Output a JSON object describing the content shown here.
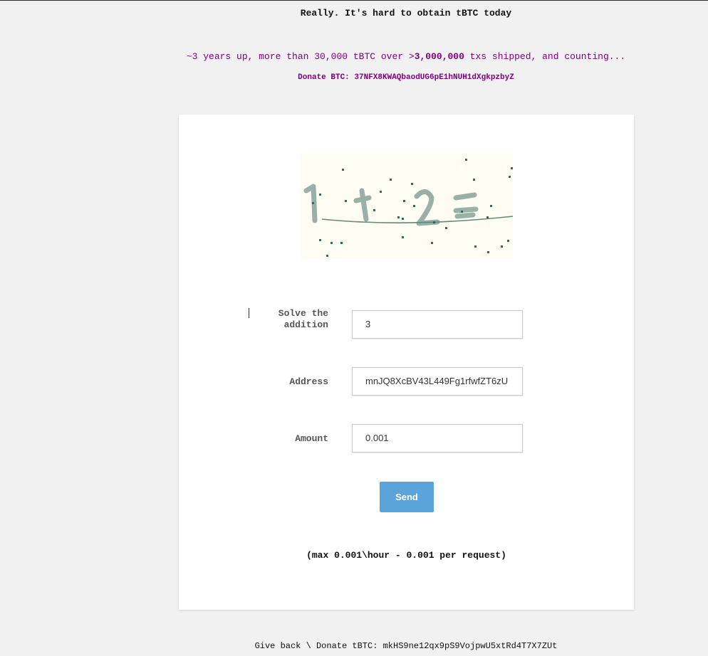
{
  "header": {
    "headline": "Really. It's hard to obtain tBTC today",
    "stats_prefix": "~3 years up, more than 30,000 tBTC over >",
    "stats_bold": "3,000,000",
    "stats_suffix": " txs shipped, and counting...",
    "donate": "Donate BTC: 37NFX8KWAQbaodUG6pE1hNUH1dXgkpzbyZ"
  },
  "captcha": {
    "text": "1 + 2 =",
    "icon": "captcha-image"
  },
  "form": {
    "solve_label_line1": "Solve the",
    "solve_label_line2": "addition",
    "solve_value": "3",
    "address_label": "Address",
    "address_value": "mnJQ8XcBV43L449Fg1rfwfZT6zU",
    "amount_label": "Amount",
    "amount_value": "0.001",
    "send_label": "Send"
  },
  "limit_note": "(max 0.001\\hour - 0.001 per request)",
  "footer": {
    "text": "Give back \\ Donate tBTC: mkHS9ne12qx9pS9VojpwU5xtRd4T7X7ZUt"
  },
  "colors": {
    "background": "#f1f1f1",
    "accent_purple": "#800080",
    "send_button": "#5aa4db"
  }
}
